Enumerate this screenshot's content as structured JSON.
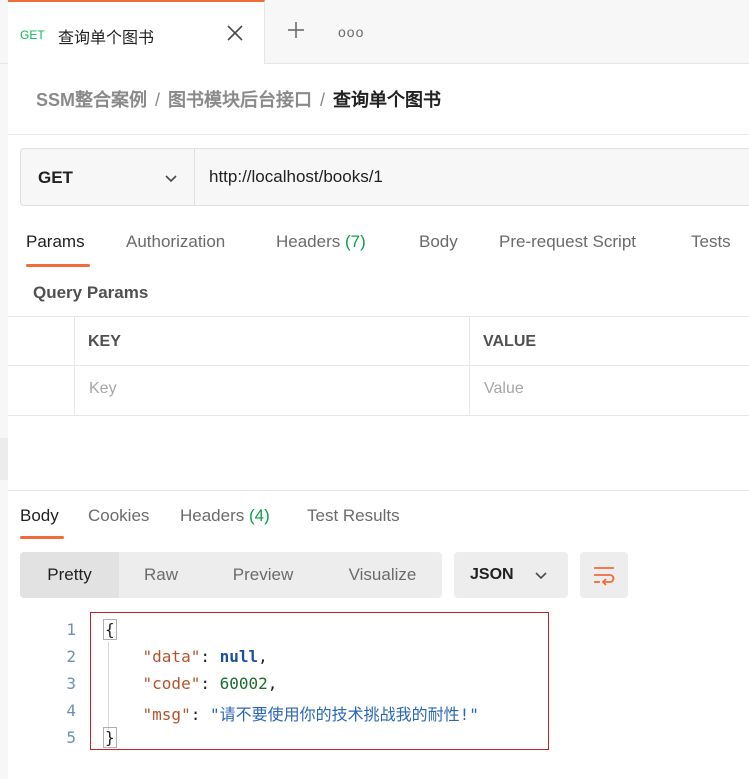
{
  "tab": {
    "method": "GET",
    "title": "查询单个图书",
    "more": "ooo"
  },
  "breadcrumb": {
    "items": [
      "SSM整合案例",
      "图书模块后台接口"
    ],
    "separator": "/",
    "current": "查询单个图书"
  },
  "request": {
    "method": "GET",
    "url": "http://localhost/books/1"
  },
  "request_tabs": [
    {
      "label": "Params",
      "count": ""
    },
    {
      "label": "Authorization",
      "count": ""
    },
    {
      "label": "Headers",
      "count": "(7)"
    },
    {
      "label": "Body",
      "count": ""
    },
    {
      "label": "Pre-request Script",
      "count": ""
    },
    {
      "label": "Tests",
      "count": ""
    }
  ],
  "query_params": {
    "title": "Query Params",
    "headers": {
      "key": "KEY",
      "value": "VALUE"
    },
    "placeholders": {
      "key": "Key",
      "value": "Value"
    }
  },
  "response_tabs": [
    {
      "label": "Body",
      "count": ""
    },
    {
      "label": "Cookies",
      "count": ""
    },
    {
      "label": "Headers",
      "count": "(4)"
    },
    {
      "label": "Test Results",
      "count": ""
    }
  ],
  "format": {
    "modes": [
      "Pretty",
      "Raw",
      "Preview",
      "Visualize"
    ],
    "active": "Pretty",
    "language": "JSON"
  },
  "response_body": {
    "line_numbers": [
      "1",
      "2",
      "3",
      "4",
      "5"
    ],
    "open_brace": "{",
    "close_brace": "}",
    "fields": [
      {
        "key": "\"data\"",
        "value": "null",
        "suffix": ","
      },
      {
        "key": "\"code\"",
        "value": "60002",
        "suffix": ","
      },
      {
        "key": "\"msg\"",
        "value": "\"请不要使用你的技术挑战我的耐性!\"",
        "suffix": ""
      }
    ]
  },
  "colors": {
    "accent": "#f26b3a",
    "get_method": "#0cbb52",
    "count": "#0aa14a",
    "highlight_border": "#c0202a"
  }
}
